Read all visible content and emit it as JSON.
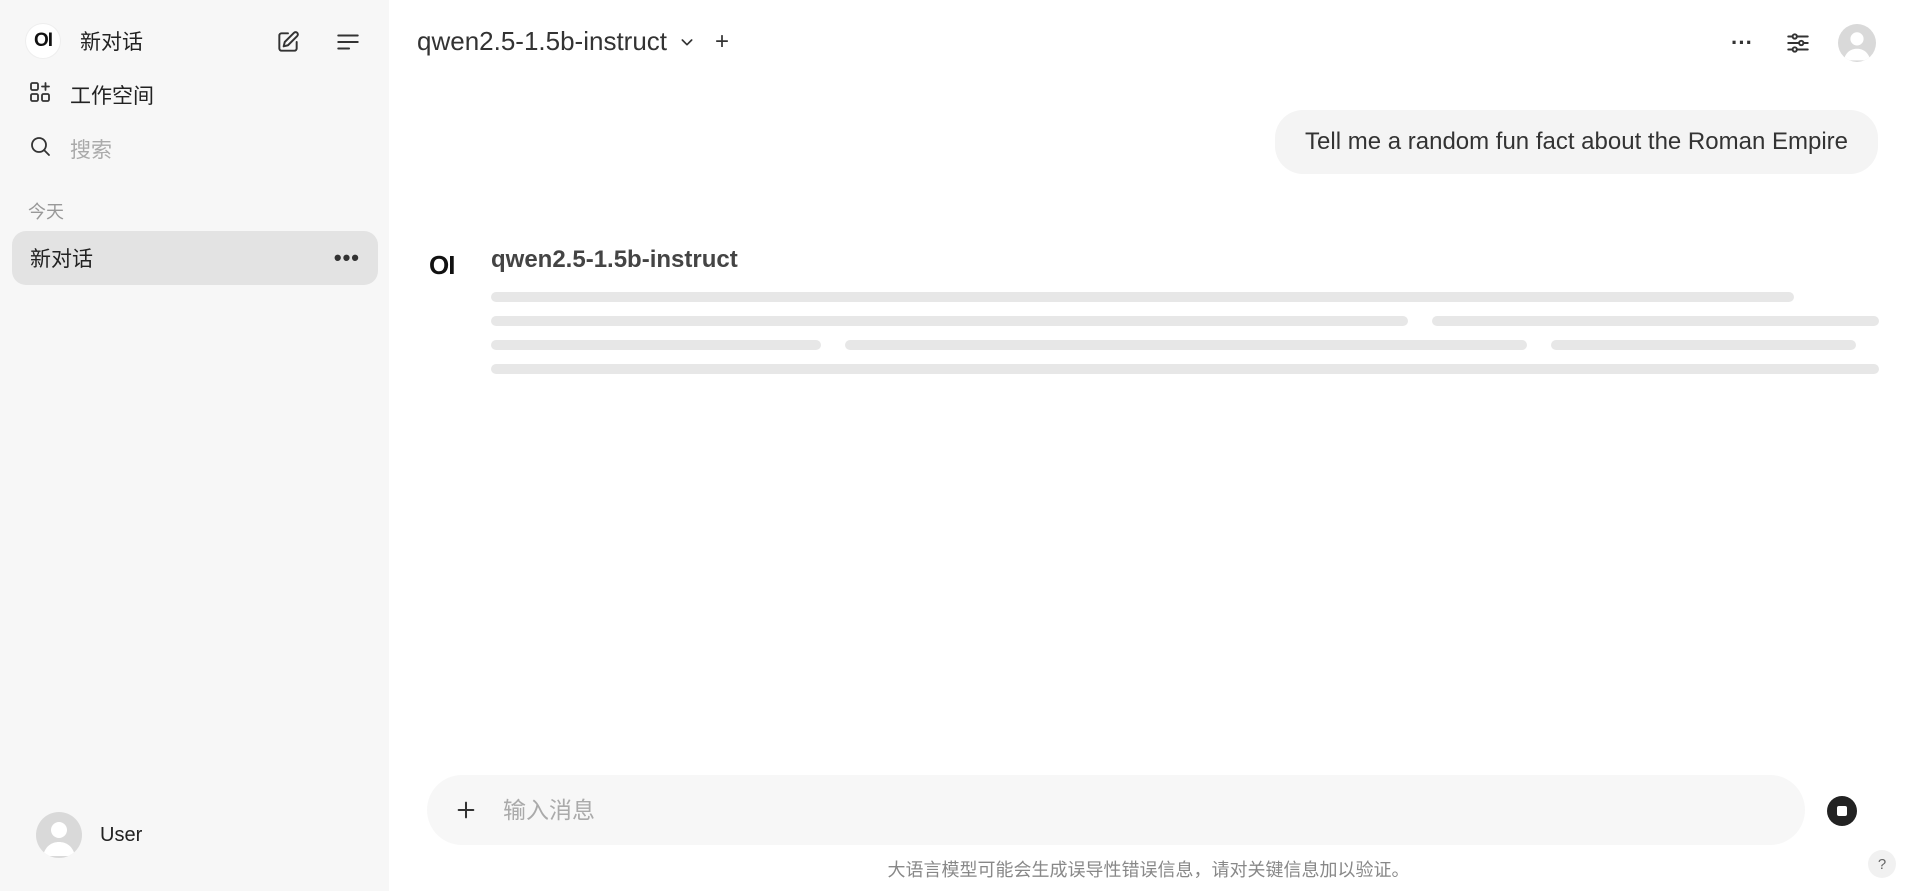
{
  "sidebar": {
    "logo_text": "OI",
    "new_chat_label": "新对话",
    "workspace_label": "工作空间",
    "search_placeholder": "搜索",
    "section_today": "今天",
    "chats": [
      {
        "title": "新对话",
        "more": "•••"
      }
    ],
    "user_name": "User"
  },
  "header": {
    "model_name": "qwen2.5-1.5b-instruct",
    "add_model": "+",
    "more": "···"
  },
  "conversation": {
    "user_message": "Tell me a random fun fact about the Roman Empire",
    "assistant_logo": "OI",
    "assistant_model": "qwen2.5-1.5b-instruct"
  },
  "composer": {
    "placeholder": "输入消息",
    "add_label": "+"
  },
  "footer": {
    "disclaimer": "大语言模型可能会生成误导性错误信息，请对关键信息加以验证。",
    "help": "?"
  },
  "icons": [
    "pencil-square-icon",
    "menu-lines-icon",
    "grid-plus-icon",
    "search-icon",
    "chevron-down-icon",
    "sliders-icon",
    "stop-icon"
  ],
  "colors": {
    "sidebar_bg": "#f7f7f7",
    "active_chat_bg": "#e3e3e3",
    "skeleton": "#e7e7e7"
  }
}
